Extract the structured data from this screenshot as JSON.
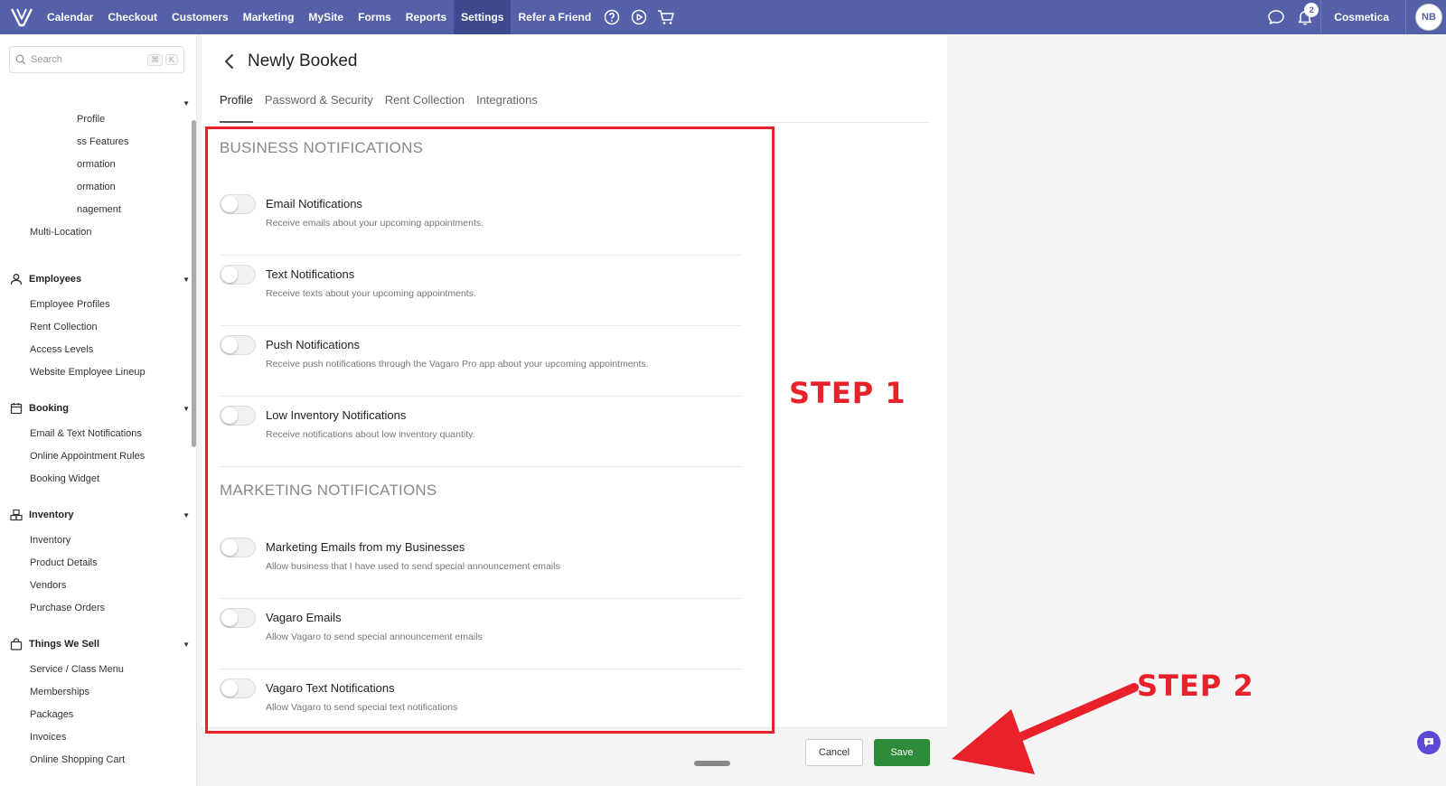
{
  "nav": {
    "items": [
      "Calendar",
      "Checkout",
      "Customers",
      "Marketing",
      "MySite",
      "Forms",
      "Reports",
      "Settings",
      "Refer a Friend"
    ],
    "active": "Settings",
    "notification_count": "2",
    "business_name": "Cosmetica",
    "avatar_initials": "NB"
  },
  "sidebar": {
    "search_placeholder": "Search",
    "shortcut_keys": [
      "⌘",
      "K"
    ],
    "business_items": [
      "Profile",
      "ss Features",
      "ormation",
      "ormation",
      "nagement",
      "Multi-Location"
    ],
    "employees": {
      "label": "Employees",
      "items": [
        "Employee Profiles",
        "Rent Collection",
        "Access Levels",
        "Website Employee Lineup"
      ]
    },
    "booking": {
      "label": "Booking",
      "items": [
        "Email & Text Notifications",
        "Online Appointment Rules",
        "Booking Widget"
      ]
    },
    "inventory": {
      "label": "Inventory",
      "items": [
        "Inventory",
        "Product Details",
        "Vendors",
        "Purchase Orders"
      ]
    },
    "things_we_sell": {
      "label": "Things We Sell",
      "items": [
        "Service / Class Menu",
        "Memberships",
        "Packages",
        "Invoices",
        "Online Shopping Cart"
      ]
    }
  },
  "page": {
    "title": "Newly Booked",
    "tabs": [
      "Profile",
      "Password & Security",
      "Rent Collection",
      "Integrations"
    ],
    "active_tab": "Profile"
  },
  "business_notifications": {
    "title": "BUSINESS NOTIFICATIONS",
    "settings": [
      {
        "label": "Email Notifications",
        "description": "Receive emails about your upcoming appointments.",
        "enabled": false
      },
      {
        "label": "Text Notifications",
        "description": "Receive texts about your upcoming appointments.",
        "enabled": false
      },
      {
        "label": "Push Notifications",
        "description": "Receive push notifications through the Vagaro Pro app about your upcoming appointments.",
        "enabled": false
      },
      {
        "label": "Low Inventory Notifications",
        "description": "Receive notifications about low inventory quantity.",
        "enabled": false
      }
    ]
  },
  "marketing_notifications": {
    "title": "MARKETING NOTIFICATIONS",
    "settings": [
      {
        "label": "Marketing Emails from my Businesses",
        "description": "Allow business that I have used to send special announcement emails",
        "enabled": false
      },
      {
        "label": "Vagaro Emails",
        "description": "Allow Vagaro to send special announcement emails",
        "enabled": false
      },
      {
        "label": "Vagaro Text Notifications",
        "description": "Allow Vagaro to send special text notifications",
        "enabled": false
      }
    ]
  },
  "footer": {
    "cancel_label": "Cancel",
    "save_label": "Save"
  },
  "annotations": {
    "step1": "STEP 1",
    "step2": "STEP 2",
    "color": "#e8212a"
  },
  "colors": {
    "nav": "#5460a8",
    "save": "#2e8b3a"
  }
}
